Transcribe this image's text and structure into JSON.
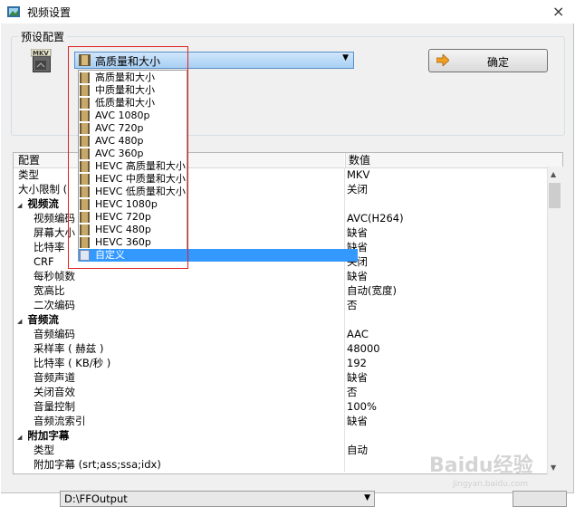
{
  "window": {
    "title": "视频设置",
    "close_glyph": "×"
  },
  "preset_group": {
    "label": "预设配置",
    "icon_text": "MKV",
    "selected": "高质量和大小",
    "ok_label": "确定",
    "options": [
      "高质量和大小",
      "中质量和大小",
      "低质量和大小",
      "AVC 1080p",
      "AVC 720p",
      "AVC 480p",
      "AVC 360p",
      "HEVC 高质量和大小",
      "HEVC 中质量和大小",
      "HEVC 低质量和大小",
      "HEVC 1080p",
      "HEVC 720p",
      "HEVC 480p",
      "HEVC 360p",
      "自定义"
    ],
    "highlighted_option": "自定义"
  },
  "grid": {
    "header_name": "配置",
    "header_value": "数值",
    "rows": [
      {
        "type": "top",
        "name": "类型",
        "value": "MKV"
      },
      {
        "type": "top",
        "name": "大小限制 (",
        "value": "关闭"
      },
      {
        "type": "cat",
        "name": "视频流",
        "value": ""
      },
      {
        "type": "sub",
        "name": "视频编码",
        "value": "AVC(H264)"
      },
      {
        "type": "sub",
        "name": "屏幕大小",
        "value": "缺省"
      },
      {
        "type": "sub",
        "name": "比特率",
        "value": "缺省"
      },
      {
        "type": "sub",
        "name": "CRF",
        "value": "关闭"
      },
      {
        "type": "sub",
        "name": "每秒帧数",
        "value": "缺省"
      },
      {
        "type": "sub",
        "name": "宽高比",
        "value": "自动(宽度)"
      },
      {
        "type": "sub",
        "name": "二次编码",
        "value": "否"
      },
      {
        "type": "cat",
        "name": "音频流",
        "value": ""
      },
      {
        "type": "sub",
        "name": "音频编码",
        "value": "AAC"
      },
      {
        "type": "sub",
        "name": "采样率 ( 赫兹 )",
        "value": "48000"
      },
      {
        "type": "sub",
        "name": "比特率 ( KB/秒 )",
        "value": "192"
      },
      {
        "type": "sub",
        "name": "音频声道",
        "value": "缺省"
      },
      {
        "type": "sub",
        "name": "关闭音效",
        "value": "否"
      },
      {
        "type": "sub",
        "name": "音量控制",
        "value": "100%"
      },
      {
        "type": "sub",
        "name": "音频流索引",
        "value": "缺省"
      },
      {
        "type": "cat",
        "name": "附加字幕",
        "value": ""
      },
      {
        "type": "sub",
        "name": "类型",
        "value": "自动"
      },
      {
        "type": "sub",
        "name": "附加字幕 (srt;ass;ssa;idx)",
        "value": ""
      }
    ]
  },
  "output": {
    "path": "D:\\FFOutput"
  },
  "watermark": {
    "text": "Baidu经验",
    "subtext": "jingyan.baidu.com"
  },
  "colors": {
    "selection": "#3399ff",
    "highlight_box": "#e02020",
    "dropdown_accent": "#5a8fc8"
  }
}
